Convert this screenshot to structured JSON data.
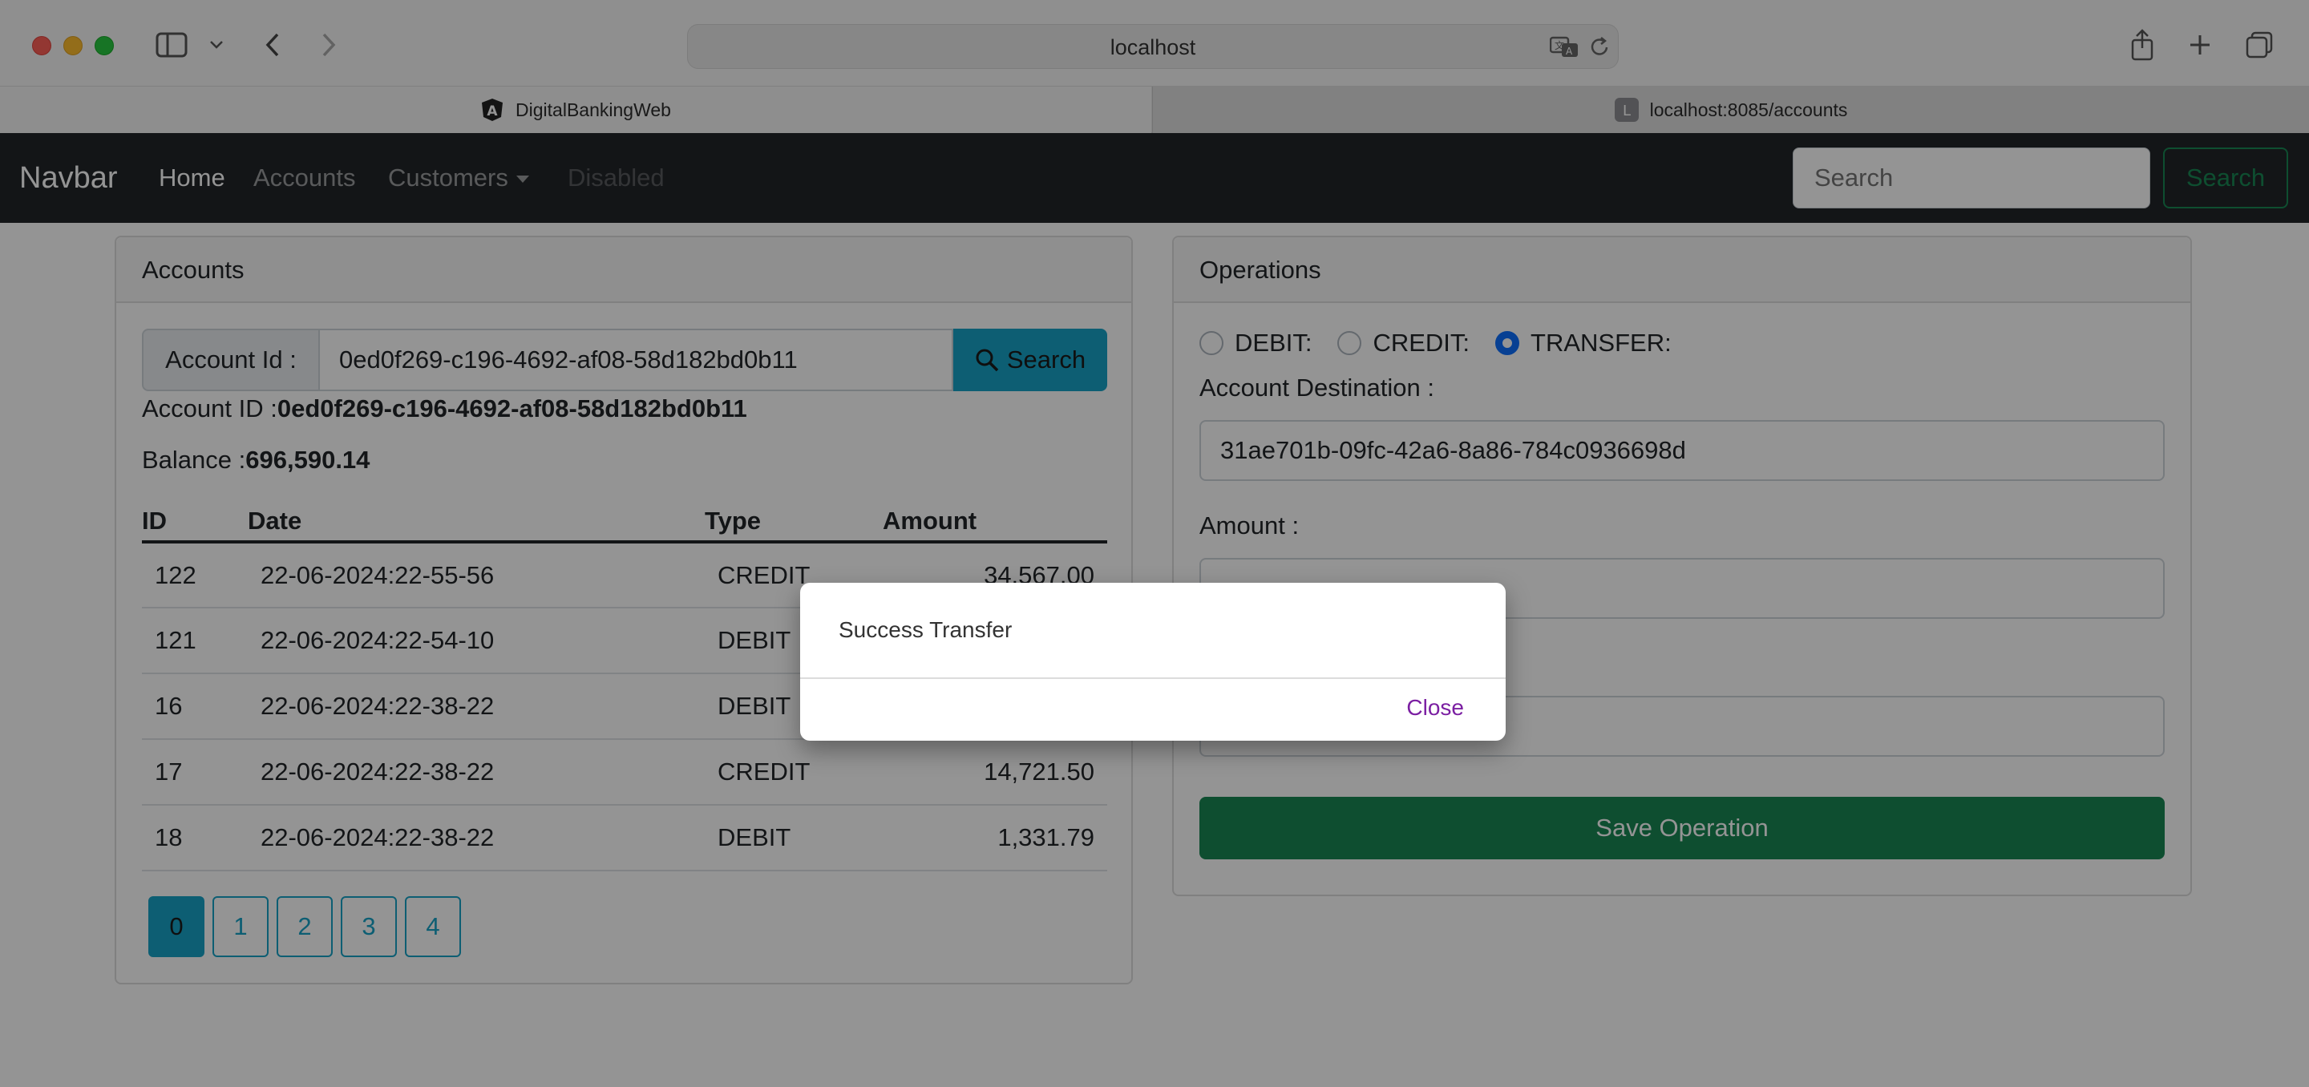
{
  "browser": {
    "url": "localhost",
    "tabs": [
      {
        "label": "DigitalBankingWeb",
        "favicon": "angular-icon"
      },
      {
        "label": "localhost:8085/accounts",
        "favicon_letter": "L"
      }
    ]
  },
  "navbar": {
    "brand": "Navbar",
    "links": [
      "Home",
      "Accounts",
      "Customers",
      "Disabled"
    ],
    "search_placeholder": "Search",
    "search_button": "Search"
  },
  "accounts": {
    "header": "Accounts",
    "id_label": "Account Id :",
    "id_value": "0ed0f269-c196-4692-af08-58d182bd0b11",
    "search_button": "Search",
    "account_id_label": "Account ID :",
    "account_id_value": "0ed0f269-c196-4692-af08-58d182bd0b11",
    "balance_label": "Balance :",
    "balance_value": "696,590.14",
    "columns": [
      "ID",
      "Date",
      "Type",
      "Amount"
    ],
    "rows": [
      {
        "id": "122",
        "date": "22-06-2024:22-55-56",
        "type": "CREDIT",
        "amount": "34,567.00"
      },
      {
        "id": "121",
        "date": "22-06-2024:22-54-10",
        "type": "DEBIT",
        "amount": ""
      },
      {
        "id": "16",
        "date": "22-06-2024:22-38-22",
        "type": "DEBIT",
        "amount": ""
      },
      {
        "id": "17",
        "date": "22-06-2024:22-38-22",
        "type": "CREDIT",
        "amount": "14,721.50"
      },
      {
        "id": "18",
        "date": "22-06-2024:22-38-22",
        "type": "DEBIT",
        "amount": "1,331.79"
      }
    ],
    "pages": [
      "0",
      "1",
      "2",
      "3",
      "4"
    ],
    "active_page": "0"
  },
  "operations": {
    "header": "Operations",
    "radios": [
      {
        "label": "DEBIT:",
        "checked": false
      },
      {
        "label": "CREDIT:",
        "checked": false
      },
      {
        "label": "TRANSFER:",
        "checked": true
      }
    ],
    "destination_label": "Account Destination :",
    "destination_value": "31ae701b-09fc-42a6-8a86-784c0936698d",
    "amount_label": "Amount :",
    "amount_value": "",
    "description_value": "",
    "save_button": "Save Operation"
  },
  "modal": {
    "message": "Success Transfer",
    "close_button": "Close"
  },
  "colors": {
    "navbar_bg": "#212529",
    "info": "#17a2c6",
    "success": "#198754",
    "primary": "#0d6efd",
    "close_link": "#7b1fa2"
  }
}
